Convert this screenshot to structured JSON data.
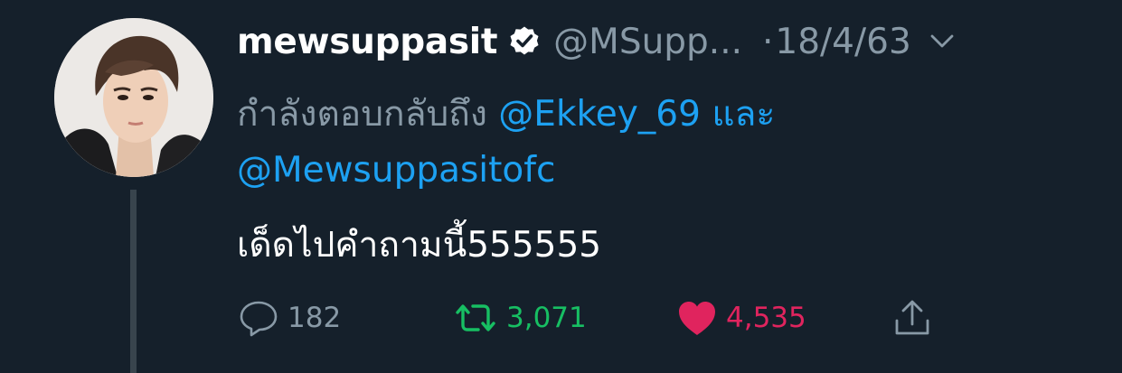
{
  "tweet": {
    "display_name": "mewsuppasit",
    "handle": "@MSupp...",
    "separator": "·",
    "date": "18/4/63",
    "reply_prefix": "กำลังตอบกลับถึง",
    "mention_1": "@Ekkey_69",
    "conjunction": "และ",
    "mention_2": "@Mewsuppasitofc",
    "text": "เด็ดไปคำถามนี้555555"
  },
  "actions": {
    "reply_count": "182",
    "retweet_count": "3,071",
    "like_count": "4,535"
  },
  "icons": {
    "verified": "verified-badge-icon",
    "chevron": "chevron-down-icon",
    "reply": "reply-bubble-icon",
    "retweet": "retweet-icon",
    "like": "heart-icon",
    "share": "share-icon"
  },
  "colors": {
    "background": "#15202b",
    "secondary_text": "#8899a6",
    "link": "#1da1f2",
    "retweet": "#17bf63",
    "like": "#e0245e",
    "thread_line": "#38444d"
  }
}
